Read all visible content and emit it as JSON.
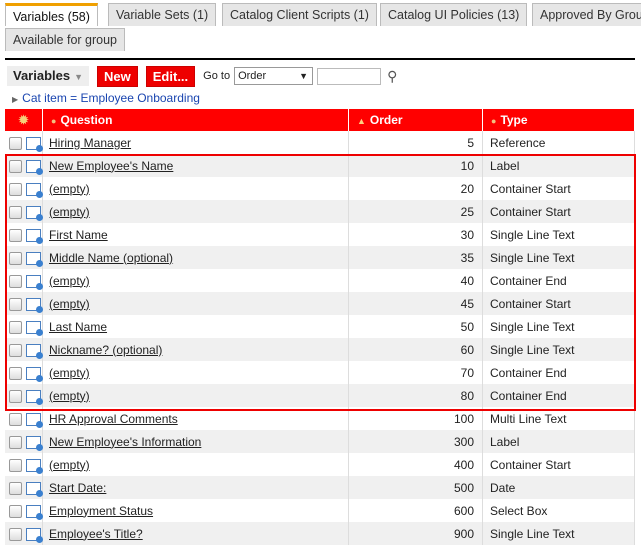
{
  "tabs": [
    "Variables (58)",
    "Variable Sets (1)",
    "Catalog Client Scripts (1)",
    "Catalog UI Policies (13)",
    "Approved By Group",
    "Available for group"
  ],
  "toolbar": {
    "title": "Variables",
    "new": "New",
    "edit": "Edit...",
    "goto": "Go to",
    "goto_value": "Order",
    "search_value": ""
  },
  "filter": "Cat item = Employee Onboarding",
  "columns": {
    "question": "Question",
    "order": "Order",
    "type": "Type"
  },
  "rows": [
    {
      "q": "Hiring Manager",
      "o": "5",
      "t": "Reference"
    },
    {
      "q": "New Employee's Name",
      "o": "10",
      "t": "Label"
    },
    {
      "q": "(empty)",
      "o": "20",
      "t": "Container Start"
    },
    {
      "q": "(empty)",
      "o": "25",
      "t": "Container Start"
    },
    {
      "q": "First Name",
      "o": "30",
      "t": "Single Line Text"
    },
    {
      "q": "Middle Name (optional)",
      "o": "35",
      "t": "Single Line Text"
    },
    {
      "q": "(empty)",
      "o": "40",
      "t": "Container End"
    },
    {
      "q": "(empty)",
      "o": "45",
      "t": "Container Start"
    },
    {
      "q": "Last Name",
      "o": "50",
      "t": "Single Line Text"
    },
    {
      "q": "Nickname? (optional)",
      "o": "60",
      "t": "Single Line Text"
    },
    {
      "q": "(empty)",
      "o": "70",
      "t": "Container End"
    },
    {
      "q": "(empty)",
      "o": "80",
      "t": "Container End"
    },
    {
      "q": "HR Approval Comments",
      "o": "100",
      "t": "Multi Line Text"
    },
    {
      "q": "New Employee's Information",
      "o": "300",
      "t": "Label"
    },
    {
      "q": "(empty)",
      "o": "400",
      "t": "Container Start"
    },
    {
      "q": "Start Date:",
      "o": "500",
      "t": "Date"
    },
    {
      "q": "Employment Status",
      "o": "600",
      "t": "Select Box"
    },
    {
      "q": "Employee's Title?",
      "o": "900",
      "t": "Single Line Text"
    }
  ]
}
